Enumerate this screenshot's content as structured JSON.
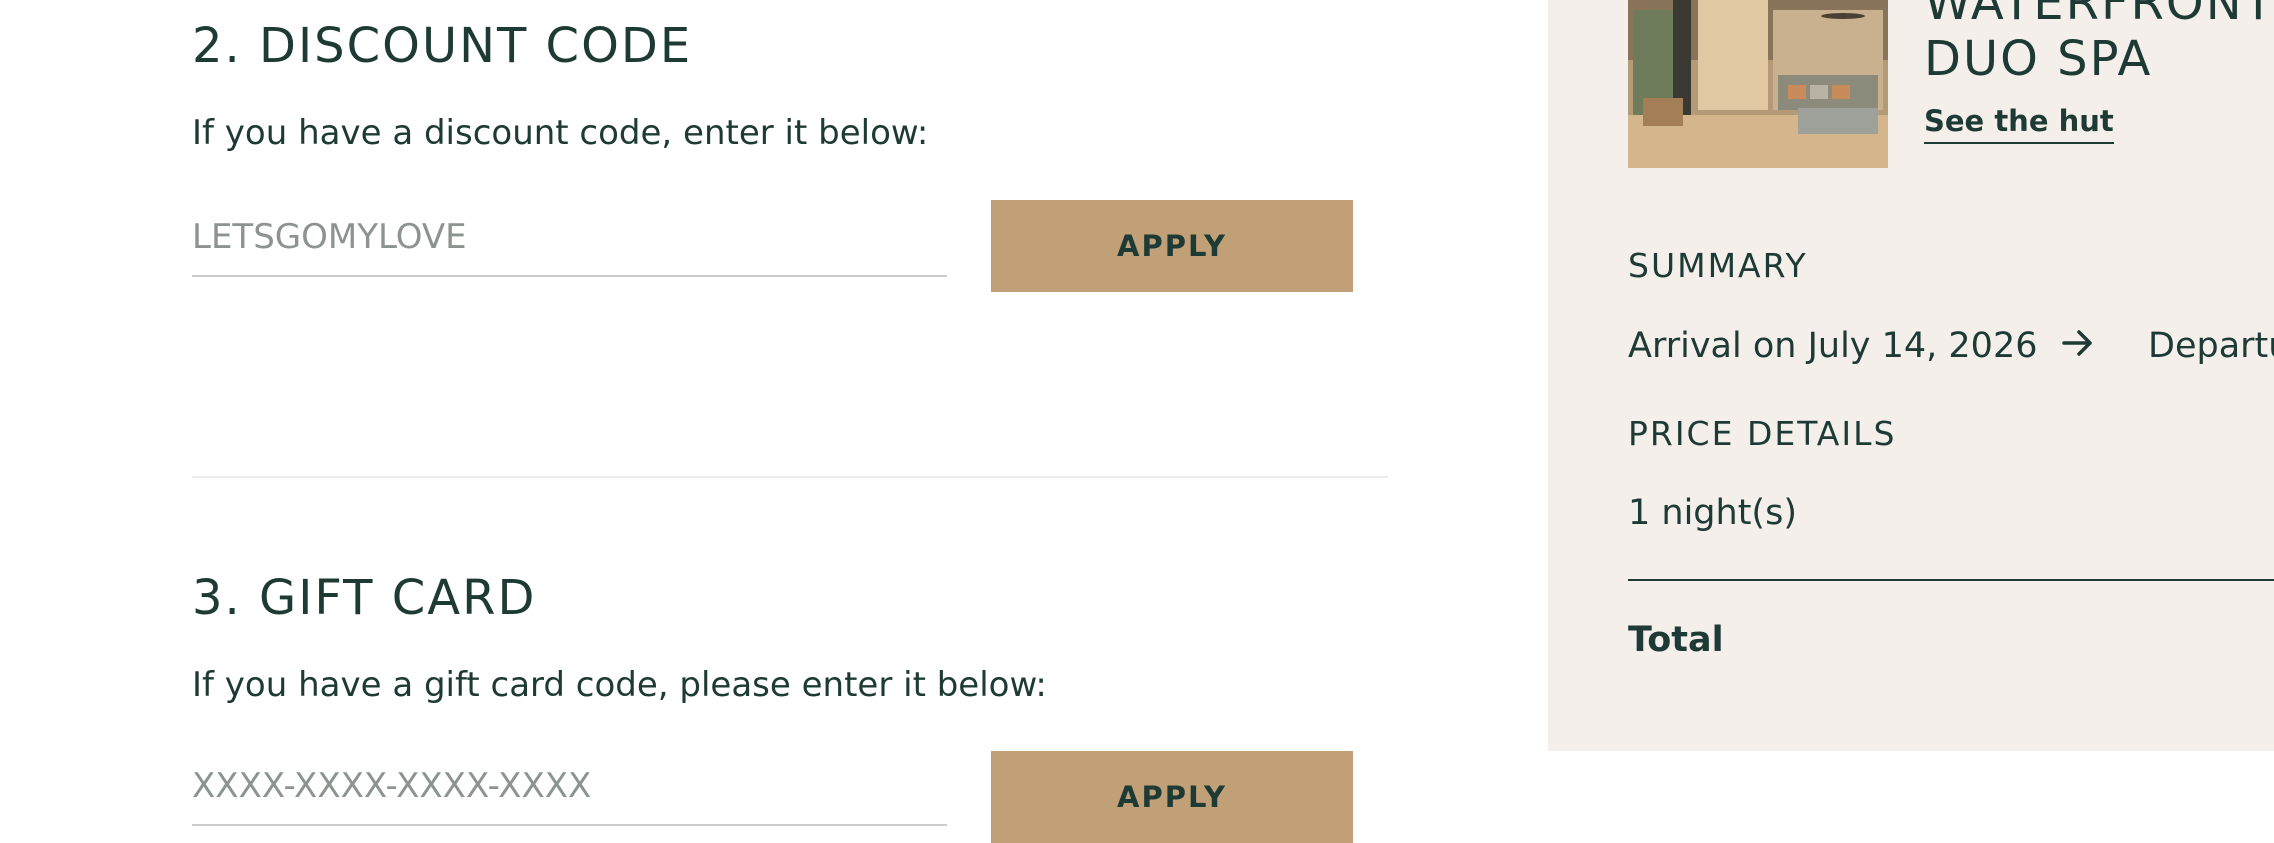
{
  "discount": {
    "title": "2. DISCOUNT CODE",
    "description": "If you have a discount code, enter it below:",
    "input_placeholder": "LETSGOMYLOVE",
    "input_value": "",
    "apply_label": "APPLY"
  },
  "gift_card": {
    "title": "3. GIFT CARD",
    "description": "If you have a gift card code, please enter it below:",
    "input_placeholder": "XXXX-XXXX-XXXX-XXXX",
    "apply_label": "APPLY"
  },
  "sidebar": {
    "hut_name_line1": "WATERFRONT",
    "hut_name_line2": "DUO SPA",
    "see_hut_label": "See the hut",
    "summary_heading": "SUMMARY",
    "arrival_text": "Arrival on July 14, 2026",
    "departure_text": "Departure",
    "price_details_heading": "PRICE DETAILS",
    "nights_text": "1 night(s)",
    "total_label": "Total"
  },
  "colors": {
    "primary_text": "#1d3a35",
    "accent_button": "#c2a077",
    "sidebar_bg": "#f4efea"
  }
}
